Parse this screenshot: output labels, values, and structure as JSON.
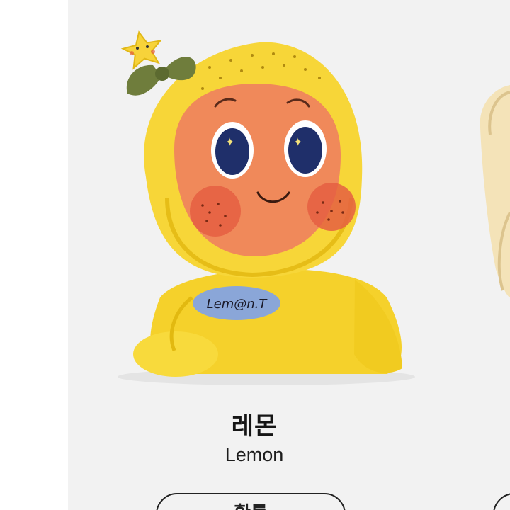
{
  "product": {
    "name_ko": "레몬",
    "name_en": "Lemon",
    "badge_text": "Lem@n.T",
    "button_label": "확률"
  },
  "colors": {
    "card_background": "#f2f2f2",
    "lemon_yellow": "#f6d630",
    "face_orange": "#f08a5a",
    "eye_navy": "#1f2f6a",
    "badge_blue": "#8aa6d8",
    "ribbon_green": "#6f7d3c"
  },
  "icons": [
    "star-charm-icon",
    "ribbon-icon"
  ]
}
